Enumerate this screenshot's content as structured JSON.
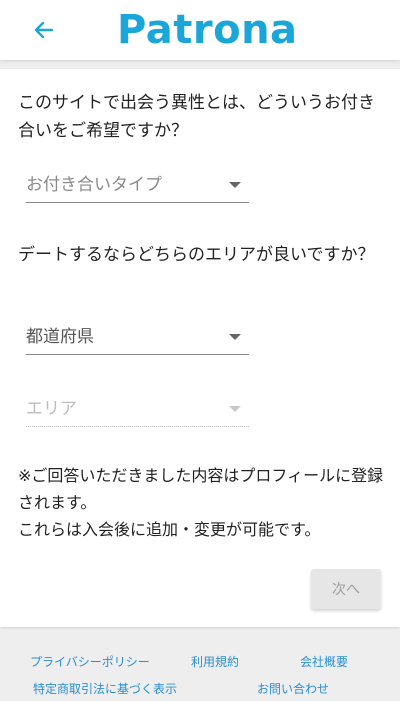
{
  "header": {
    "logo_text": "Patrona",
    "back_icon": "arrow-left-icon",
    "accent_color": "#1aa6d9"
  },
  "form": {
    "question1": "このサイトで出会う異性とは、どういうお付き合いをご希望ですか？",
    "relationship_select": {
      "placeholder": "お付き合いタイプ"
    },
    "question2": "デートするならどちらのエリアが良いですか？",
    "prefecture_select": {
      "value": "都道府県"
    },
    "area_select": {
      "placeholder": "エリア",
      "disabled": true
    },
    "notice_line1": "※ご回答いただきました内容はプロフィールに登録されます。",
    "notice_line2": "これらは入会後に追加・変更が可能です。",
    "next_label": "次へ"
  },
  "footer": {
    "links": [
      "プライバシーポリシー",
      "利用規約",
      "会社概要",
      "特定商取引法に基づく表示",
      "お問い合わせ"
    ]
  }
}
